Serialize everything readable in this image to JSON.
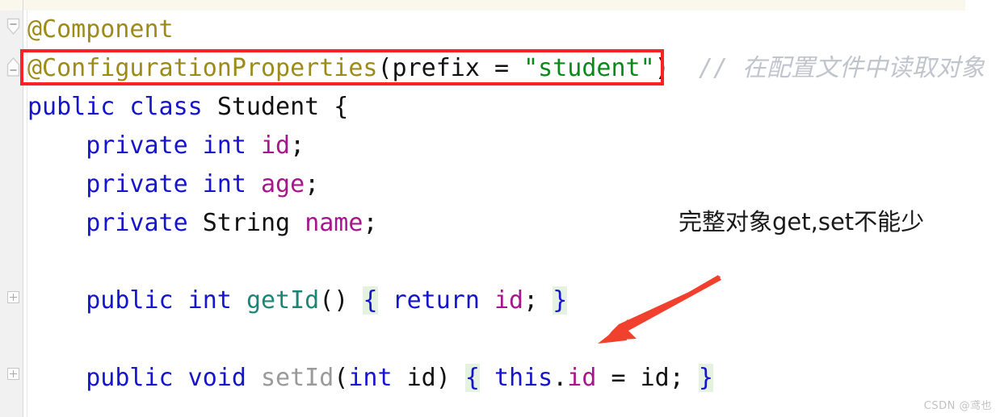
{
  "editor": {
    "top_partial_line_highlight_color": "#faf8ec",
    "gutter_color": "#f1f1f1",
    "background": "#ffffff",
    "lines": [
      {
        "id": "line-annotation-component",
        "fold_marker": "collapse-arrow",
        "tokens": [
          {
            "text": "@Component",
            "kind": "annotation"
          }
        ]
      },
      {
        "id": "line-annotation-configurationproperties",
        "fold_marker": "collapse-stub",
        "tokens": [
          {
            "text": "@ConfigurationProperties",
            "kind": "annotation"
          },
          {
            "text": "(",
            "kind": "plain"
          },
          {
            "text": "prefix",
            "kind": "plain"
          },
          {
            "text": " = ",
            "kind": "plain"
          },
          {
            "text": "\"student\"",
            "kind": "string"
          },
          {
            "text": ")",
            "kind": "plain"
          },
          {
            "text": "  // ",
            "kind": "comment"
          },
          {
            "text": "在配置文件中读取对象",
            "kind": "comment-cn"
          }
        ]
      },
      {
        "id": "line-class-declaration",
        "fold_marker": "none",
        "tokens": [
          {
            "text": "public class ",
            "kind": "keyword"
          },
          {
            "text": "Student {",
            "kind": "plain"
          }
        ]
      },
      {
        "id": "line-field-id",
        "fold_marker": "none",
        "tokens": [
          {
            "text": "    private int ",
            "kind": "keyword"
          },
          {
            "text": "id",
            "kind": "field"
          },
          {
            "text": ";",
            "kind": "plain"
          }
        ]
      },
      {
        "id": "line-field-age",
        "fold_marker": "none",
        "tokens": [
          {
            "text": "    private int ",
            "kind": "keyword"
          },
          {
            "text": "age",
            "kind": "field"
          },
          {
            "text": ";",
            "kind": "plain"
          }
        ]
      },
      {
        "id": "line-field-name",
        "fold_marker": "none",
        "tokens": [
          {
            "text": "    private ",
            "kind": "keyword"
          },
          {
            "text": "String ",
            "kind": "plain"
          },
          {
            "text": "name",
            "kind": "field"
          },
          {
            "text": ";",
            "kind": "plain"
          }
        ]
      },
      {
        "id": "line-blank-1",
        "fold_marker": "none",
        "tokens": []
      },
      {
        "id": "line-method-getid",
        "fold_marker": "expand-box",
        "tokens": [
          {
            "text": "    public int ",
            "kind": "keyword"
          },
          {
            "text": "getId",
            "kind": "method"
          },
          {
            "text": "()",
            "kind": "plain"
          },
          {
            "text": " ",
            "kind": "plain"
          },
          {
            "text": "{",
            "kind": "brace-highlight"
          },
          {
            "text": " ",
            "kind": "plain"
          },
          {
            "text": "return ",
            "kind": "keyword"
          },
          {
            "text": "id",
            "kind": "field"
          },
          {
            "text": ";",
            "kind": "plain"
          },
          {
            "text": " ",
            "kind": "plain"
          },
          {
            "text": "}",
            "kind": "brace-highlight"
          }
        ]
      },
      {
        "id": "line-blank-2",
        "fold_marker": "none",
        "tokens": []
      },
      {
        "id": "line-method-setid",
        "fold_marker": "expand-box",
        "tokens": [
          {
            "text": "    public void ",
            "kind": "keyword"
          },
          {
            "text": "setId",
            "kind": "gray"
          },
          {
            "text": "(",
            "kind": "plain"
          },
          {
            "text": "int ",
            "kind": "keyword"
          },
          {
            "text": "id",
            "kind": "plain"
          },
          {
            "text": ")",
            "kind": "plain"
          },
          {
            "text": " ",
            "kind": "plain"
          },
          {
            "text": "{",
            "kind": "brace-highlight"
          },
          {
            "text": " ",
            "kind": "plain"
          },
          {
            "text": "this",
            "kind": "keyword"
          },
          {
            "text": ".",
            "kind": "plain"
          },
          {
            "text": "id",
            "kind": "field"
          },
          {
            "text": " = ",
            "kind": "plain"
          },
          {
            "text": "id",
            "kind": "plain"
          },
          {
            "text": ";",
            "kind": "plain"
          },
          {
            "text": " ",
            "kind": "plain"
          },
          {
            "text": "}",
            "kind": "brace-highlight"
          }
        ]
      }
    ]
  },
  "annotations": {
    "red_box": {
      "label": "configuration-properties-highlight",
      "color": "#fa2222"
    },
    "note_text": "完整对象get,set不能少",
    "arrow": {
      "label": "red-arrow-pointing-to-setter",
      "color": "#f2402e"
    }
  },
  "watermark": {
    "text": "CSDN @鸢也"
  },
  "colors": {
    "annotation": "#9d8b19",
    "keyword": "#1515cc",
    "field": "#a6168c",
    "string": "#0a8a18",
    "method": "#1d8577",
    "comment": "#c0c4cc",
    "gray_method": "#9a9a9a",
    "brace_highlight": "#e6f2e0",
    "red": "#fa2222"
  }
}
